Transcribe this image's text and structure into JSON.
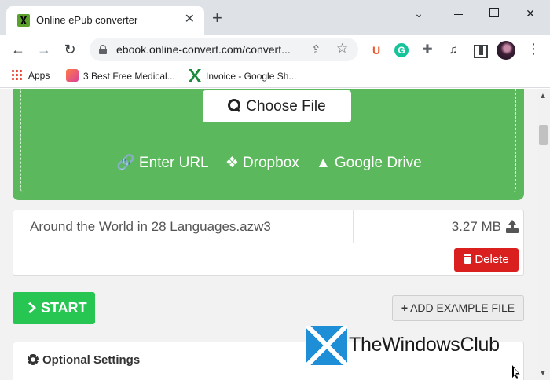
{
  "browser": {
    "tab": {
      "title": "Online ePub converter",
      "close": "✕"
    },
    "new_tab": "+",
    "window_controls": {
      "chevron": "⌄",
      "close": "✕"
    },
    "nav": {
      "back": "←",
      "forward": "→",
      "reload": "↻"
    },
    "address_bar": {
      "url": "ebook.online-convert.com/convert...",
      "share": "⇪",
      "star": "☆"
    },
    "extensions": {
      "u": "U",
      "g": "G",
      "puzzle": "✚",
      "media": "♫",
      "menu": "⋮"
    },
    "bookmarks": [
      {
        "label": "Apps"
      },
      {
        "label": "3 Best Free Medical..."
      },
      {
        "label": "Invoice - Google Sh..."
      }
    ]
  },
  "upload": {
    "choose_file": "Choose File",
    "sources": [
      {
        "label": "Enter URL",
        "icon": "🔗"
      },
      {
        "label": "Dropbox",
        "icon": "❖"
      },
      {
        "label": "Google Drive",
        "icon": "▲"
      }
    ]
  },
  "file": {
    "name": "Around the World in 28 Languages.azw3",
    "size": "3.27 MB",
    "delete_label": "Delete"
  },
  "actions": {
    "start_label": "START",
    "example_label": "ADD EXAMPLE FILE",
    "example_plus": "+"
  },
  "settings": {
    "title": "Optional Settings"
  },
  "scroll": {
    "up": "▲",
    "down": "▼"
  },
  "watermark": {
    "text": "TheWindowsClub"
  },
  "colors": {
    "green_panel": "#5cb85c",
    "start_green": "#27c653",
    "delete_red": "#d9201f"
  }
}
